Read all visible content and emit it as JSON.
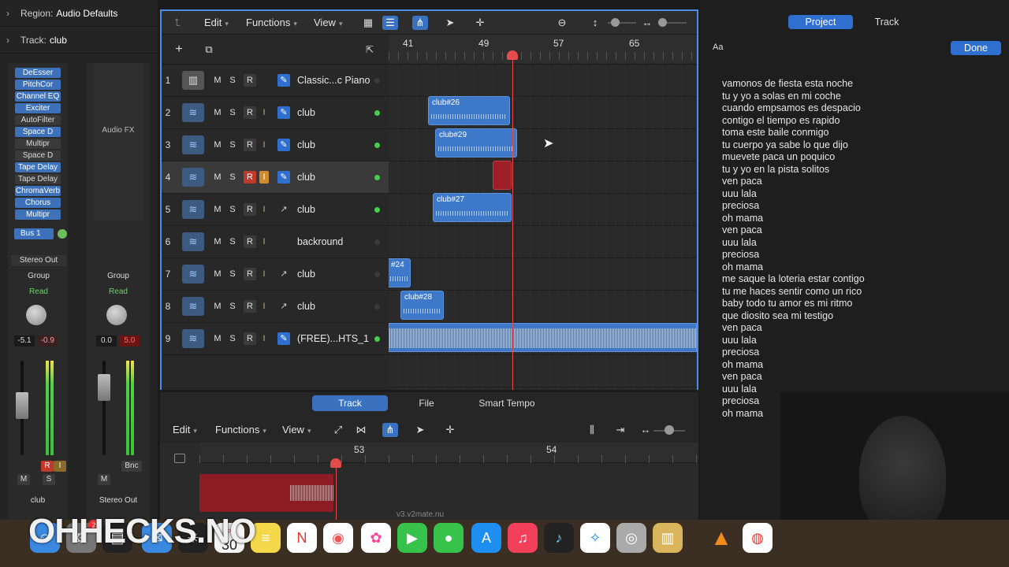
{
  "inspector": {
    "region_label": "Region:",
    "region_value": "Audio Defaults",
    "track_label": "Track:",
    "track_value": "club",
    "plugins": [
      "DeEsser",
      "PitchCor",
      "Channel EQ",
      "Exciter",
      "AutoFilter",
      "Space D",
      "Multipr",
      "Space D",
      "Tape Delay",
      "Tape Delay",
      "ChromaVerb",
      "Chorus",
      "Multipr"
    ],
    "plugins_active": [
      true,
      true,
      true,
      true,
      false,
      true,
      false,
      false,
      true,
      false,
      true,
      true,
      true
    ],
    "audio_fx_label": "Audio FX",
    "bus": "Bus 1",
    "stereo_out": "Stereo Out",
    "group": "Group",
    "read": "Read",
    "left_strip": {
      "pan": "-5.1",
      "peak": "-0.9",
      "name": "club",
      "r": "R",
      "i": "I",
      "m": "M",
      "s": "S"
    },
    "right_strip": {
      "pan": "0.0",
      "peak": "5.0",
      "name": "Stereo Out",
      "m": "M",
      "bnc": "Bnc"
    }
  },
  "toolbar": {
    "back": "⮤",
    "edit": "Edit",
    "functions": "Functions",
    "view": "View"
  },
  "track_header_tools": {
    "add": "+",
    "folder": "⧉",
    "collapse": "⇱"
  },
  "ruler": {
    "marks": [
      "41",
      "49",
      "57",
      "65"
    ]
  },
  "tracks": [
    {
      "num": "1",
      "name": "Classic...c Piano",
      "icon": "piano",
      "selected": false,
      "rec": false,
      "input": false,
      "dot": false,
      "auto": "pencil"
    },
    {
      "num": "2",
      "name": "club",
      "icon": "wave",
      "selected": false,
      "rec": false,
      "input": false,
      "dot": true,
      "auto": "pencil"
    },
    {
      "num": "3",
      "name": "club",
      "icon": "wave",
      "selected": false,
      "rec": false,
      "input": false,
      "dot": true,
      "auto": "pencil"
    },
    {
      "num": "4",
      "name": "club",
      "icon": "wave",
      "selected": true,
      "rec": true,
      "input": true,
      "dot": true,
      "auto": "pencil"
    },
    {
      "num": "5",
      "name": "club",
      "icon": "wave",
      "selected": false,
      "rec": false,
      "input": false,
      "dot": true,
      "auto": "line"
    },
    {
      "num": "6",
      "name": "backround",
      "icon": "wave",
      "selected": false,
      "rec": false,
      "input": false,
      "dot": false,
      "auto": "none"
    },
    {
      "num": "7",
      "name": "club",
      "icon": "wave",
      "selected": false,
      "rec": false,
      "input": false,
      "dot": false,
      "auto": "line"
    },
    {
      "num": "8",
      "name": "club",
      "icon": "wave",
      "selected": false,
      "rec": false,
      "input": false,
      "dot": false,
      "auto": "line"
    },
    {
      "num": "9",
      "name": "(FREE)...HTS_1",
      "icon": "wave",
      "selected": false,
      "rec": false,
      "input": false,
      "dot": true,
      "auto": "pencil"
    }
  ],
  "track_buttons": {
    "m": "M",
    "s": "S",
    "r": "R",
    "i": "I"
  },
  "regions": {
    "r26": "club#26",
    "r29": "club#29",
    "r27": "club#27",
    "r24": "#24",
    "r28": "club#28"
  },
  "editor": {
    "tabs": [
      "Track",
      "File",
      "Smart Tempo"
    ],
    "edit": "Edit",
    "functions": "Functions",
    "view": "View",
    "ruler_marks": [
      "53",
      "54"
    ],
    "filename": "v3.v2mate.nu"
  },
  "right_panel": {
    "tab_project": "Project",
    "tab_track": "Track",
    "aa": "Aa",
    "done": "Done",
    "lyrics": [
      "vamonos de fiesta esta noche",
      "tu y yo a solas en mi coche",
      "cuando empsamos es despacio",
      "contigo el tiempo es rapido",
      "toma este baile conmigo",
      "tu cuerpo ya sabe lo que dijo",
      "muevete paca un poquico",
      "tu y yo en la pista solitos",
      "ven paca",
      "uuu lala",
      "preciosa",
      "oh mama",
      "ven paca",
      "uuu lala",
      "preciosa",
      "oh mama",
      "me saque la loteria estar contigo",
      "tu me haces sentir como un rico",
      "baby todo tu amor es mi ritmo",
      "que diosito sea mi testigo",
      "ven paca",
      "uuu lala",
      "preciosa",
      "oh mama",
      "ven paca",
      "uuu lala",
      "preciosa",
      "oh mama"
    ]
  },
  "watermark": "OHHECKS.NO",
  "dock": {
    "calendar_day": "30",
    "calendar_month": "APR",
    "badge": "2"
  }
}
